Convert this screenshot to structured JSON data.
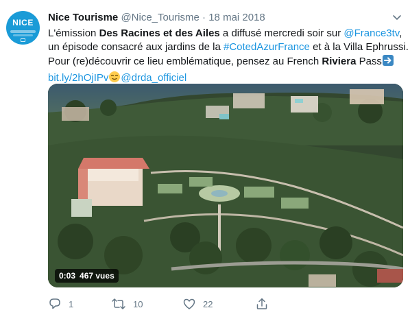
{
  "tweet": {
    "avatar_text": "NICE",
    "display_name": "Nice Tourisme",
    "handle": "@Nice_Tourisme",
    "separator": "·",
    "date": "18 mai 2018",
    "line1_pre": "L'émission ",
    "line1_bold": "Des Racines et des Ailes",
    "line1_mid": " a diffusé mercredi soir sur ",
    "line1_link": "@France3tv",
    "line1_post": ",",
    "line2_pre": "un épisode consacré aux jardins de la ",
    "line2_link": "#CotedAzurFrance",
    "line2_post": " et à la Villa Ephrussi.",
    "line3_pre": "Pour (re)découvrir ce lieu emblématique, pensez au French ",
    "line3_bold": "Riviera",
    "line3_post": " Pass",
    "line4_link1": "bit.ly/2hOjIPv",
    "line4_link2": "@drda_officiel"
  },
  "video": {
    "time": "0:03",
    "views": "467 vues"
  },
  "actions": {
    "reply_count": "1",
    "retweet_count": "10",
    "like_count": "22"
  },
  "colors": {
    "link": "#1b95e0",
    "secondary": "#657786",
    "avatar_bg": "#1a9bd7"
  }
}
